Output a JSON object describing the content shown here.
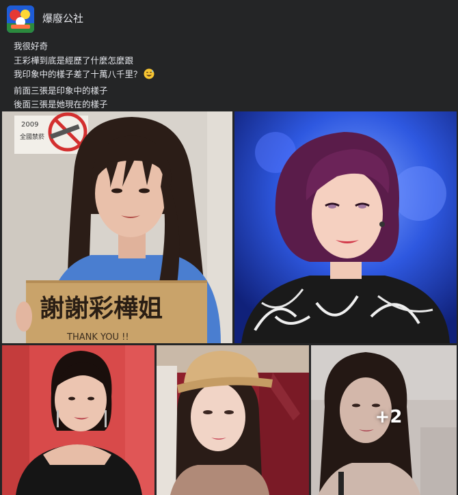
{
  "post": {
    "page_name": "爆廢公社",
    "lines": [
      "我很好奇",
      "王彩樺到底是經歷了什麼怎麼跟",
      "我印象中的樣子差了十萬八千里？",
      "前面三張是印象中的樣子",
      "後面三張是她現在的樣子"
    ],
    "emoji": "grinning-sweat-emoji"
  },
  "photos": {
    "photo1": {
      "sign_text": "謝謝彩樺姐",
      "sign_subtext": "THANK YOU !!",
      "poster_year": "2009",
      "poster_text": "全國禁菸"
    },
    "more_count": "+2"
  }
}
